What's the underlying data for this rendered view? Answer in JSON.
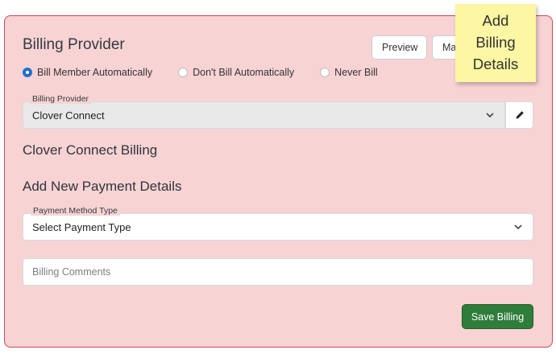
{
  "billing": {
    "title": "Billing Provider",
    "preview_label": "Preview",
    "manage_label": "Ma",
    "radios": [
      {
        "label": "Bill Member Automatically",
        "checked": true
      },
      {
        "label": "Don't Bill Automatically",
        "checked": false
      },
      {
        "label": "Never Bill",
        "checked": false
      }
    ],
    "provider_field": {
      "label": "Billing Provider",
      "value": "Clover Connect",
      "edit_icon": "pencil-icon"
    },
    "provider_heading": "Clover Connect Billing",
    "payment_heading": "Add New Payment Details",
    "payment_field": {
      "label": "Payment Method Type",
      "value": "Select Payment Type"
    },
    "comments_placeholder": "Billing Comments",
    "save_label": "Save Billing"
  },
  "sticky_note": {
    "line1": "Add",
    "line2": "Billing",
    "line3": "Details"
  },
  "colors": {
    "panel_bg": "#f8d3d4",
    "panel_border": "#c94a4f",
    "accent": "#1f6fd1",
    "save_bg": "#2f7d3a",
    "note_bg": "#fdf6a3"
  }
}
